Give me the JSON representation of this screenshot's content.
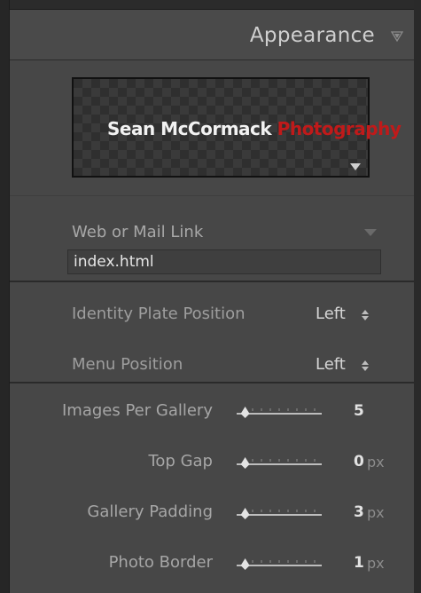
{
  "header": {
    "title": "Appearance",
    "collapse_icon": "triangle-down-icon"
  },
  "identity_plate": {
    "name_text": "Sean McCormack",
    "photo_text": "Photography",
    "name_color": "#f2f2f2",
    "photo_color": "#c01a1a"
  },
  "web_link": {
    "label": "Web or Mail Link",
    "value": "index.html"
  },
  "positions": [
    {
      "label": "Identity Plate Position",
      "value": "Left"
    },
    {
      "label": "Menu Position",
      "value": "Left"
    }
  ],
  "sliders": [
    {
      "label": "Images Per Gallery",
      "value": "5",
      "unit": "",
      "level": 0.1
    },
    {
      "label": "Top Gap",
      "value": "0",
      "unit": "px",
      "level": 0.1
    },
    {
      "label": "Gallery Padding",
      "value": "3",
      "unit": "px",
      "level": 0.1
    },
    {
      "label": "Photo Border",
      "value": "1",
      "unit": "px",
      "level": 0.1
    }
  ]
}
